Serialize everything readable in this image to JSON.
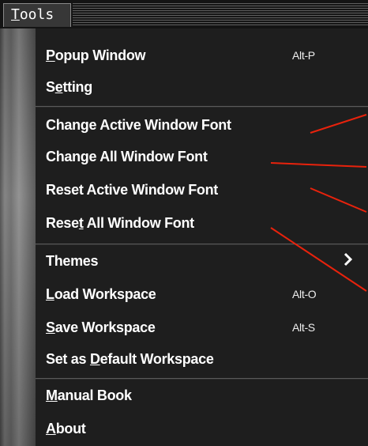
{
  "menubar": {
    "tools_label": {
      "first": "T",
      "rest": "ools"
    }
  },
  "menu": {
    "items": [
      {
        "first": "P",
        "rest": "opup Window",
        "accel": "Alt-P"
      },
      {
        "pre": "S",
        "u": "e",
        "post": "tting"
      },
      {
        "text": "Change Active Window Font"
      },
      {
        "text": "Change All Window Font"
      },
      {
        "text": "Reset Active Window Font"
      },
      {
        "pre": "Rese",
        "u": "t",
        "post": " All Window Font"
      },
      {
        "text": "Themes"
      },
      {
        "first": "L",
        "rest": "oad Workspace",
        "accel": "Alt-O"
      },
      {
        "first": "S",
        "rest": "ave Workspace",
        "accel": "Alt-S"
      },
      {
        "pre": "Set as ",
        "u": "D",
        "post": "efault Workspace"
      },
      {
        "first": "M",
        "rest": "anual Book"
      },
      {
        "first": "A",
        "rest": "bout"
      }
    ]
  },
  "colors": {
    "menu_bg": "#1e1e1e",
    "menubar_bg": "#141414",
    "text": "#ffffff",
    "annotation_line": "#e8220c"
  },
  "icons": {
    "submenu": "chevron-right-icon"
  }
}
